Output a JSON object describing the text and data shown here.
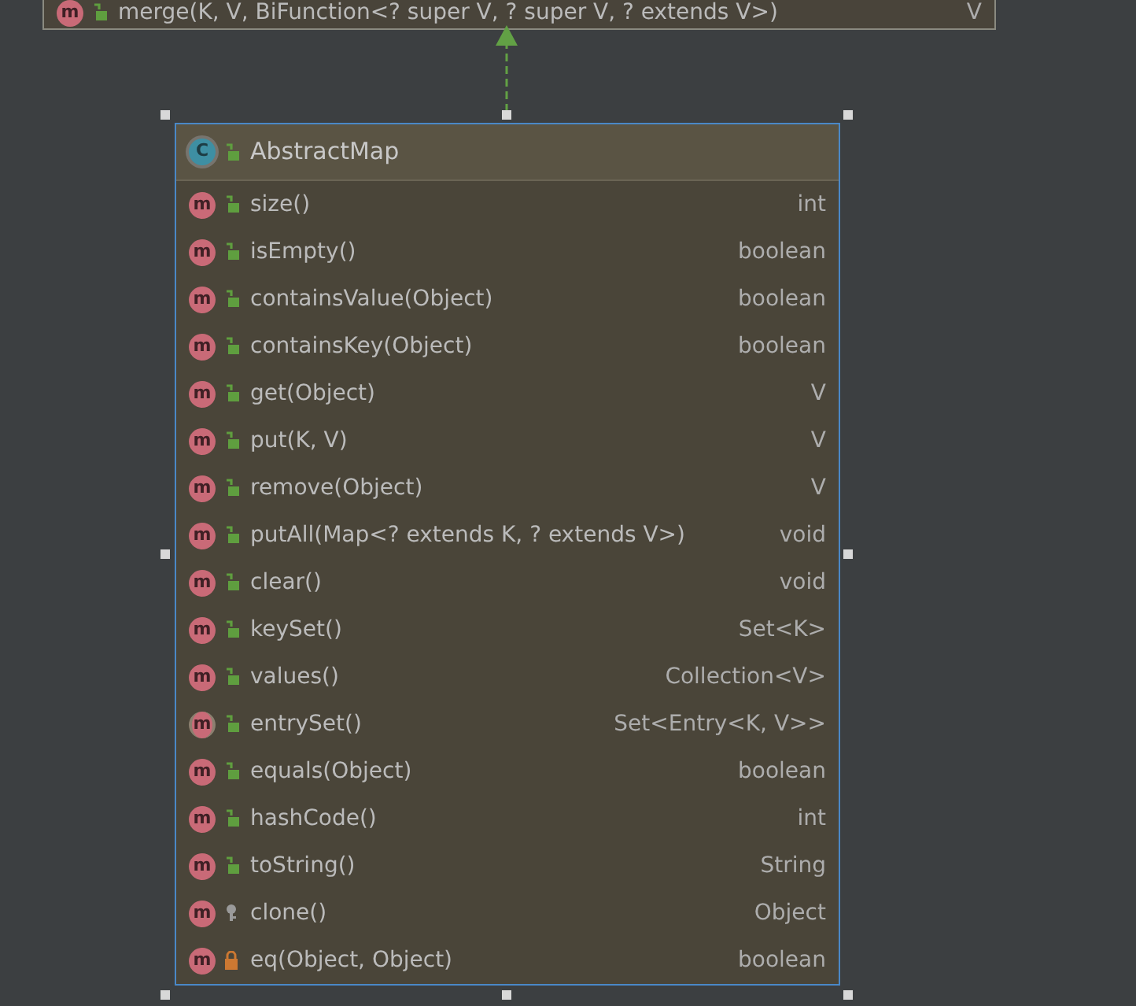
{
  "top_class": {
    "members": [
      {
        "badge": "m",
        "access": {
          "kind": "public"
        },
        "name": "merge(K, V, BiFunction<? super V, ? super V, ? extends V>)",
        "type": "V"
      }
    ]
  },
  "class": {
    "badge": "C",
    "access": {
      "kind": "public"
    },
    "name": "AbstractMap",
    "selected": true,
    "members": [
      {
        "badge": "m",
        "abstract": false,
        "access": {
          "kind": "public"
        },
        "name": "size()",
        "type": "int"
      },
      {
        "badge": "m",
        "abstract": false,
        "access": {
          "kind": "public"
        },
        "name": "isEmpty()",
        "type": "boolean"
      },
      {
        "badge": "m",
        "abstract": false,
        "access": {
          "kind": "public"
        },
        "name": "containsValue(Object)",
        "type": "boolean"
      },
      {
        "badge": "m",
        "abstract": false,
        "access": {
          "kind": "public"
        },
        "name": "containsKey(Object)",
        "type": "boolean"
      },
      {
        "badge": "m",
        "abstract": false,
        "access": {
          "kind": "public"
        },
        "name": "get(Object)",
        "type": "V"
      },
      {
        "badge": "m",
        "abstract": false,
        "access": {
          "kind": "public"
        },
        "name": "put(K, V)",
        "type": "V"
      },
      {
        "badge": "m",
        "abstract": false,
        "access": {
          "kind": "public"
        },
        "name": "remove(Object)",
        "type": "V"
      },
      {
        "badge": "m",
        "abstract": false,
        "access": {
          "kind": "public"
        },
        "name": "putAll(Map<? extends K, ? extends V>)",
        "type": "void"
      },
      {
        "badge": "m",
        "abstract": false,
        "access": {
          "kind": "public"
        },
        "name": "clear()",
        "type": "void"
      },
      {
        "badge": "m",
        "abstract": false,
        "access": {
          "kind": "public"
        },
        "name": "keySet()",
        "type": "Set<K>"
      },
      {
        "badge": "m",
        "abstract": false,
        "access": {
          "kind": "public"
        },
        "name": "values()",
        "type": "Collection<V>"
      },
      {
        "badge": "m",
        "abstract": true,
        "access": {
          "kind": "public"
        },
        "name": "entrySet()",
        "type": "Set<Entry<K, V>>"
      },
      {
        "badge": "m",
        "abstract": false,
        "access": {
          "kind": "public"
        },
        "name": "equals(Object)",
        "type": "boolean"
      },
      {
        "badge": "m",
        "abstract": false,
        "access": {
          "kind": "public"
        },
        "name": "hashCode()",
        "type": "int"
      },
      {
        "badge": "m",
        "abstract": false,
        "access": {
          "kind": "public"
        },
        "name": "toString()",
        "type": "String"
      },
      {
        "badge": "m",
        "abstract": false,
        "access": {
          "kind": "protected"
        },
        "name": "clone()",
        "type": "Object"
      },
      {
        "badge": "m",
        "abstract": false,
        "access": {
          "kind": "private"
        },
        "name": "eq(Object, Object)",
        "type": "boolean"
      }
    ]
  }
}
